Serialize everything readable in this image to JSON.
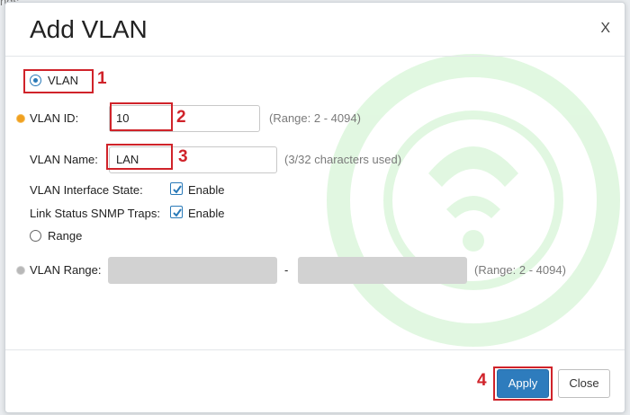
{
  "backdrop": {
    "text": "ngs"
  },
  "dialog": {
    "title": "Add VLAN",
    "close_glyph": "X",
    "vlan_option": {
      "label": "VLAN",
      "checked": true
    },
    "vlan_id": {
      "label": "VLAN ID:",
      "value": "10",
      "hint": "(Range: 2 - 4094)",
      "icon": "required-icon"
    },
    "vlan_name": {
      "label": "VLAN Name:",
      "value": "LAN",
      "hint": "(3/32 characters used)"
    },
    "interface_state": {
      "label": "VLAN Interface State:",
      "checkbox_label": "Enable",
      "checked": true
    },
    "snmp_traps": {
      "label": "Link Status SNMP Traps:",
      "checkbox_label": "Enable",
      "checked": true
    },
    "range_option": {
      "label": "Range",
      "checked": false
    },
    "vlan_range": {
      "label": "VLAN Range:",
      "separator": "-",
      "start_value": "",
      "end_value": "",
      "hint": "(Range: 2 - 4094)",
      "icon": "required-icon-disabled"
    },
    "footer": {
      "apply_label": "Apply",
      "close_label": "Close"
    }
  },
  "annotations": {
    "step1": "1",
    "step2": "2",
    "step3": "3",
    "step4": "4",
    "color": "#d0232a"
  },
  "colors": {
    "accent": "#2e7cbd",
    "required": "#f0a020",
    "disabled_field": "#d2d2d2"
  }
}
